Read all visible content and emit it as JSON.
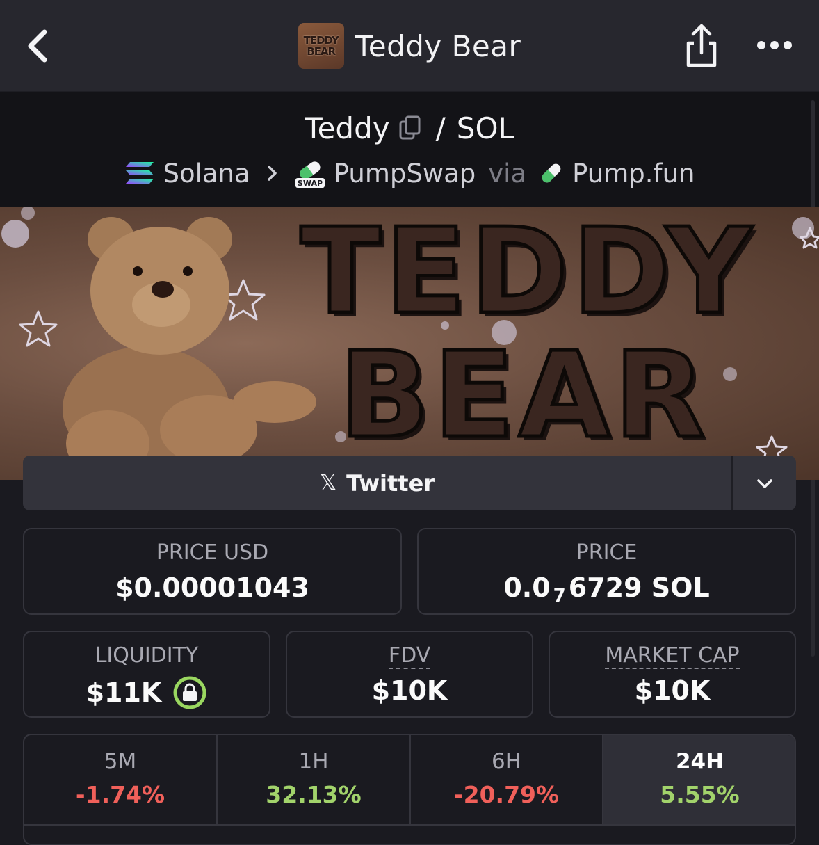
{
  "header": {
    "title": "Teddy Bear",
    "logo_lines": [
      "TEDDY",
      "BEAR"
    ]
  },
  "pair": {
    "base": "Teddy",
    "separator": "/",
    "quote": "SOL",
    "chain": "Solana",
    "dex": "PumpSwap",
    "dex_badge": "SWAP",
    "via": "via",
    "launchpad": "Pump.fun"
  },
  "banner": {
    "line1": "TEDDY",
    "line2": "BEAR"
  },
  "links": {
    "twitter_label": "Twitter"
  },
  "stats": {
    "price_usd": {
      "label": "PRICE USD",
      "value": "$0.00001043"
    },
    "price": {
      "label": "PRICE",
      "prefix": "0.0",
      "zeros": "7",
      "digits": "6729",
      "unit": "SOL"
    },
    "liquidity": {
      "label": "LIQUIDITY",
      "value": "$11K"
    },
    "fdv": {
      "label": "FDV",
      "value": "$10K"
    },
    "market_cap": {
      "label": "MARKET CAP",
      "value": "$10K"
    }
  },
  "timeframes": [
    {
      "label": "5M",
      "change": "-1.74%",
      "trend": "negative"
    },
    {
      "label": "1H",
      "change": "32.13%",
      "trend": "positive"
    },
    {
      "label": "6H",
      "change": "-20.79%",
      "trend": "negative"
    },
    {
      "label": "24H",
      "change": "5.55%",
      "trend": "positive",
      "selected": true
    }
  ],
  "colors": {
    "negative": "#f0605a",
    "positive": "#a2d36b",
    "lock_ring": "#9ad760"
  }
}
